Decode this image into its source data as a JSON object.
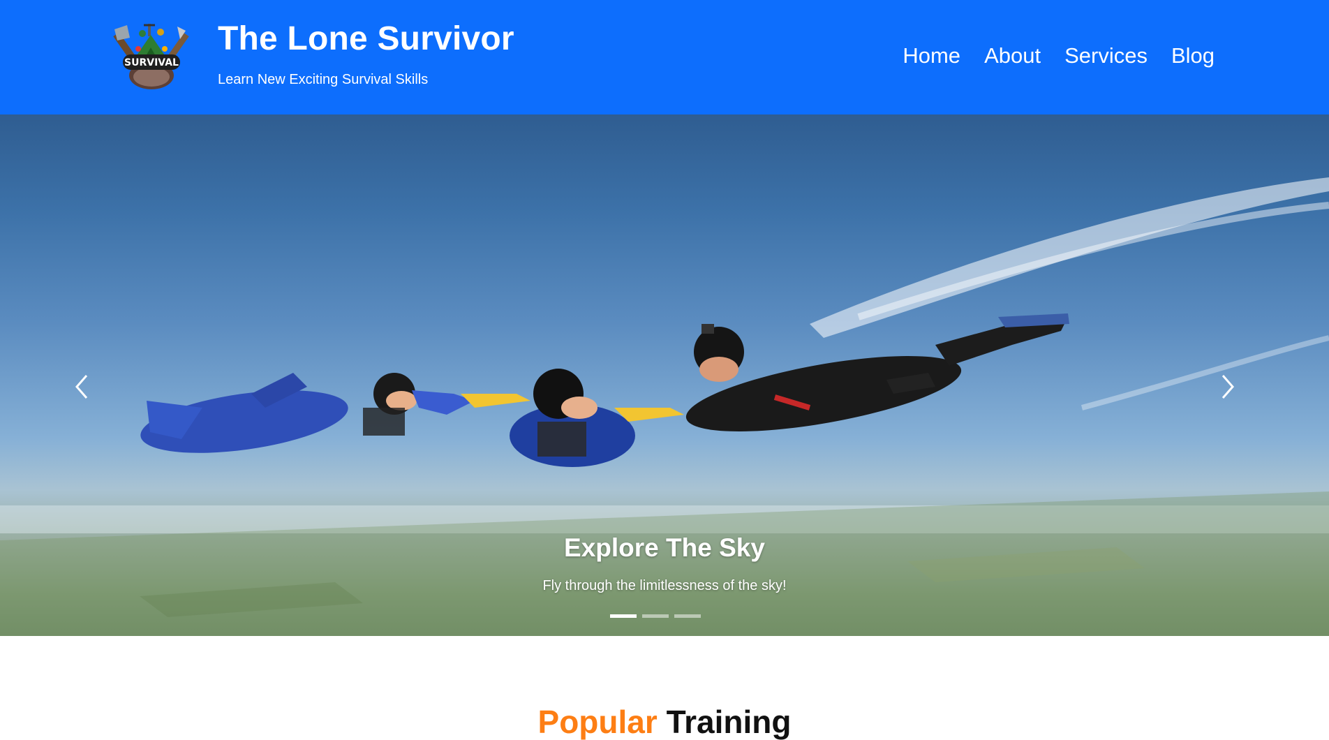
{
  "header": {
    "logo_icon": "survival-badge-icon",
    "logo_text": "SURVIVAL",
    "title": "The Lone Survivor",
    "tagline": "Learn New Exciting Survival Skills",
    "background": "#0d6efd",
    "nav": [
      {
        "label": "Home"
      },
      {
        "label": "About"
      },
      {
        "label": "Services"
      },
      {
        "label": "Blog"
      }
    ]
  },
  "carousel": {
    "caption_title": "Explore The Sky",
    "caption_text": "Fly through the limitlessness of the sky!",
    "prev_icon": "chevron-left-icon",
    "next_icon": "chevron-right-icon",
    "slide_count": 3,
    "active_slide": 1
  },
  "section": {
    "heading_accent": "Popular",
    "heading_rest": "Training",
    "accent_color": "#fd7e14"
  }
}
